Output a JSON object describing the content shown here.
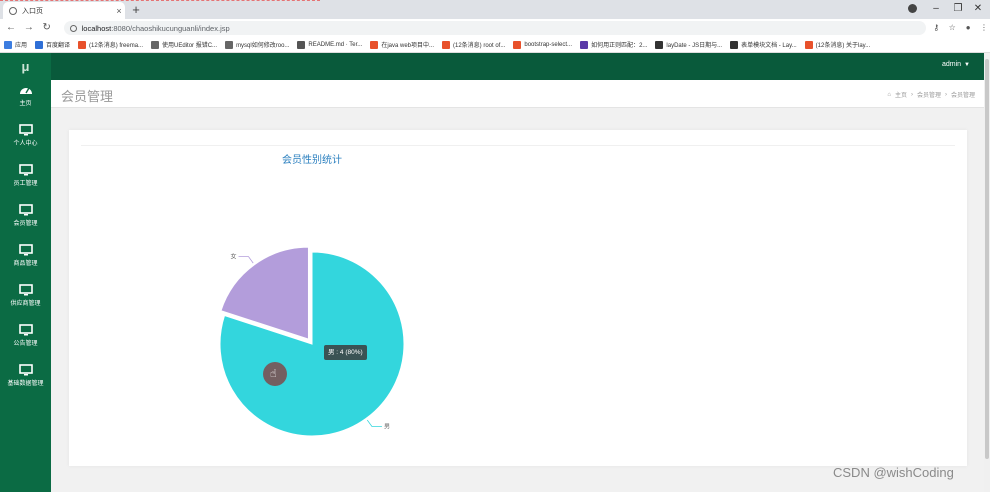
{
  "browser": {
    "tab_title": "入口页",
    "url_host": "localhost",
    "url_path": ":8080/chaoshikucunguanli/index.jsp",
    "bookmarks": [
      {
        "label": "应用",
        "color": "#3c7de0"
      },
      {
        "label": "百度翻译",
        "color": "#2f6fd6"
      },
      {
        "label": "(12条消息) freema...",
        "color": "#e8512b"
      },
      {
        "label": "使用UEditor 报错C...",
        "color": "#666666"
      },
      {
        "label": "mysql如何修改roo...",
        "color": "#666666"
      },
      {
        "label": "README.md · Ter...",
        "color": "#555555"
      },
      {
        "label": "在java web项目中...",
        "color": "#e8512b"
      },
      {
        "label": "(12条消息) root of...",
        "color": "#e8512b"
      },
      {
        "label": "bootstrap-select...",
        "color": "#e8512b"
      },
      {
        "label": "如何用正则匹配：2...",
        "color": "#5a3aa8"
      },
      {
        "label": "layDate - JS日期与...",
        "color": "#333333"
      },
      {
        "label": "表单模块文档 - Lay...",
        "color": "#333333"
      },
      {
        "label": "(12条消息) 关于lay...",
        "color": "#e8512b"
      }
    ]
  },
  "app": {
    "logo": "μ",
    "user": "admin",
    "sidebar": [
      {
        "label": "主页",
        "icon": "dashboard-icon"
      },
      {
        "label": "个人中心",
        "icon": "monitor-icon"
      },
      {
        "label": "员工管理",
        "icon": "monitor-icon"
      },
      {
        "label": "会员管理",
        "icon": "monitor-icon"
      },
      {
        "label": "商品管理",
        "icon": "monitor-icon"
      },
      {
        "label": "供应商管理",
        "icon": "monitor-icon"
      },
      {
        "label": "公告管理",
        "icon": "monitor-icon"
      },
      {
        "label": "基础数据管理",
        "icon": "monitor-icon"
      }
    ],
    "page_title": "会员管理",
    "breadcrumb": [
      "主页",
      "会员管理",
      "会员管理"
    ],
    "colors": {
      "sidebar": "#0b6b44",
      "topbar": "#095a3b",
      "title": "#2a7fbf"
    }
  },
  "tooltip": "男 : 4 (80%)",
  "watermark": "CSDN @wishCoding",
  "chart_data": {
    "type": "pie",
    "title": "会员性别统计",
    "categories": [
      "男",
      "女"
    ],
    "values": [
      4,
      1
    ],
    "colors": [
      "#33d6dd",
      "#b39ddb"
    ]
  }
}
